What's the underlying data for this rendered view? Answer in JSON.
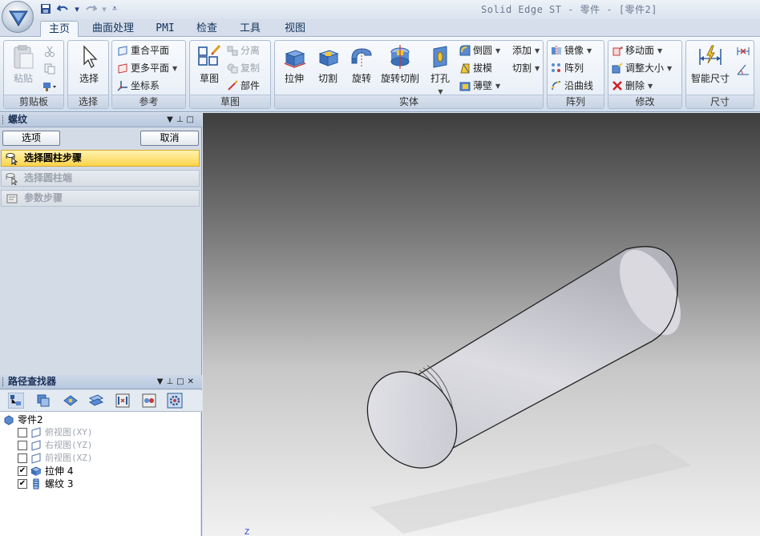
{
  "app": {
    "title": "Solid Edge ST - 零件 - [零件2]"
  },
  "tabs": [
    {
      "label": "主页",
      "active": true
    },
    {
      "label": "曲面处理",
      "active": false
    },
    {
      "label": "PMI",
      "active": false
    },
    {
      "label": "检查",
      "active": false
    },
    {
      "label": "工具",
      "active": false
    },
    {
      "label": "视图",
      "active": false
    }
  ],
  "ribbon": {
    "clipboard": {
      "label": "剪贴板",
      "paste": "粘贴"
    },
    "select": {
      "label": "选择",
      "select": "选择"
    },
    "reference": {
      "label": "参考",
      "coincident_plane": "重合平面",
      "more_planes": "更多平面",
      "coord_system": "坐标系"
    },
    "sketch": {
      "label": "草图",
      "sketch": "草图",
      "separate": "分离",
      "copy": "复制",
      "part": "部件"
    },
    "solid": {
      "label": "实体",
      "extrude": "拉伸",
      "cut": "切割",
      "revolve": "旋转",
      "revolve_cut": "旋转切削",
      "hole": "打孔",
      "round": "倒圆",
      "draft": "拔模",
      "thin_wall": "薄壁",
      "add": "添加",
      "cut2": "切割"
    },
    "pattern": {
      "label": "阵列",
      "mirror": "镜像",
      "pattern": "阵列",
      "along_curve": "沿曲线"
    },
    "modify": {
      "label": "修改",
      "move_face": "移动面",
      "resize": "调整大小",
      "delete": "删除"
    },
    "dimension": {
      "label": "尺寸",
      "smart_dim": "智能尺寸"
    }
  },
  "thread_pane": {
    "title": "螺纹",
    "options_button": "选项",
    "cancel_button": "取消",
    "steps": [
      {
        "label": "选择圆柱步骤",
        "active": true
      },
      {
        "label": "选择圆柱端",
        "active": false
      },
      {
        "label": "参数步骤",
        "active": false
      }
    ]
  },
  "pathfinder": {
    "title": "路径查找器",
    "root": "零件2",
    "items": [
      {
        "label": "俯视图(XY)",
        "checked": false,
        "enabled": false
      },
      {
        "label": "右视图(YZ)",
        "checked": false,
        "enabled": false
      },
      {
        "label": "前视图(XZ)",
        "checked": false,
        "enabled": false
      },
      {
        "label": "拉伸 4",
        "checked": true,
        "enabled": true
      },
      {
        "label": "螺纹 3",
        "checked": true,
        "enabled": true
      }
    ]
  },
  "viewport": {
    "axis_label": "Z"
  },
  "colors": {
    "active_step": "#fbd44c",
    "ribbon_blue": "#2a5a9c",
    "selection_yellow": "#fff3b0"
  }
}
